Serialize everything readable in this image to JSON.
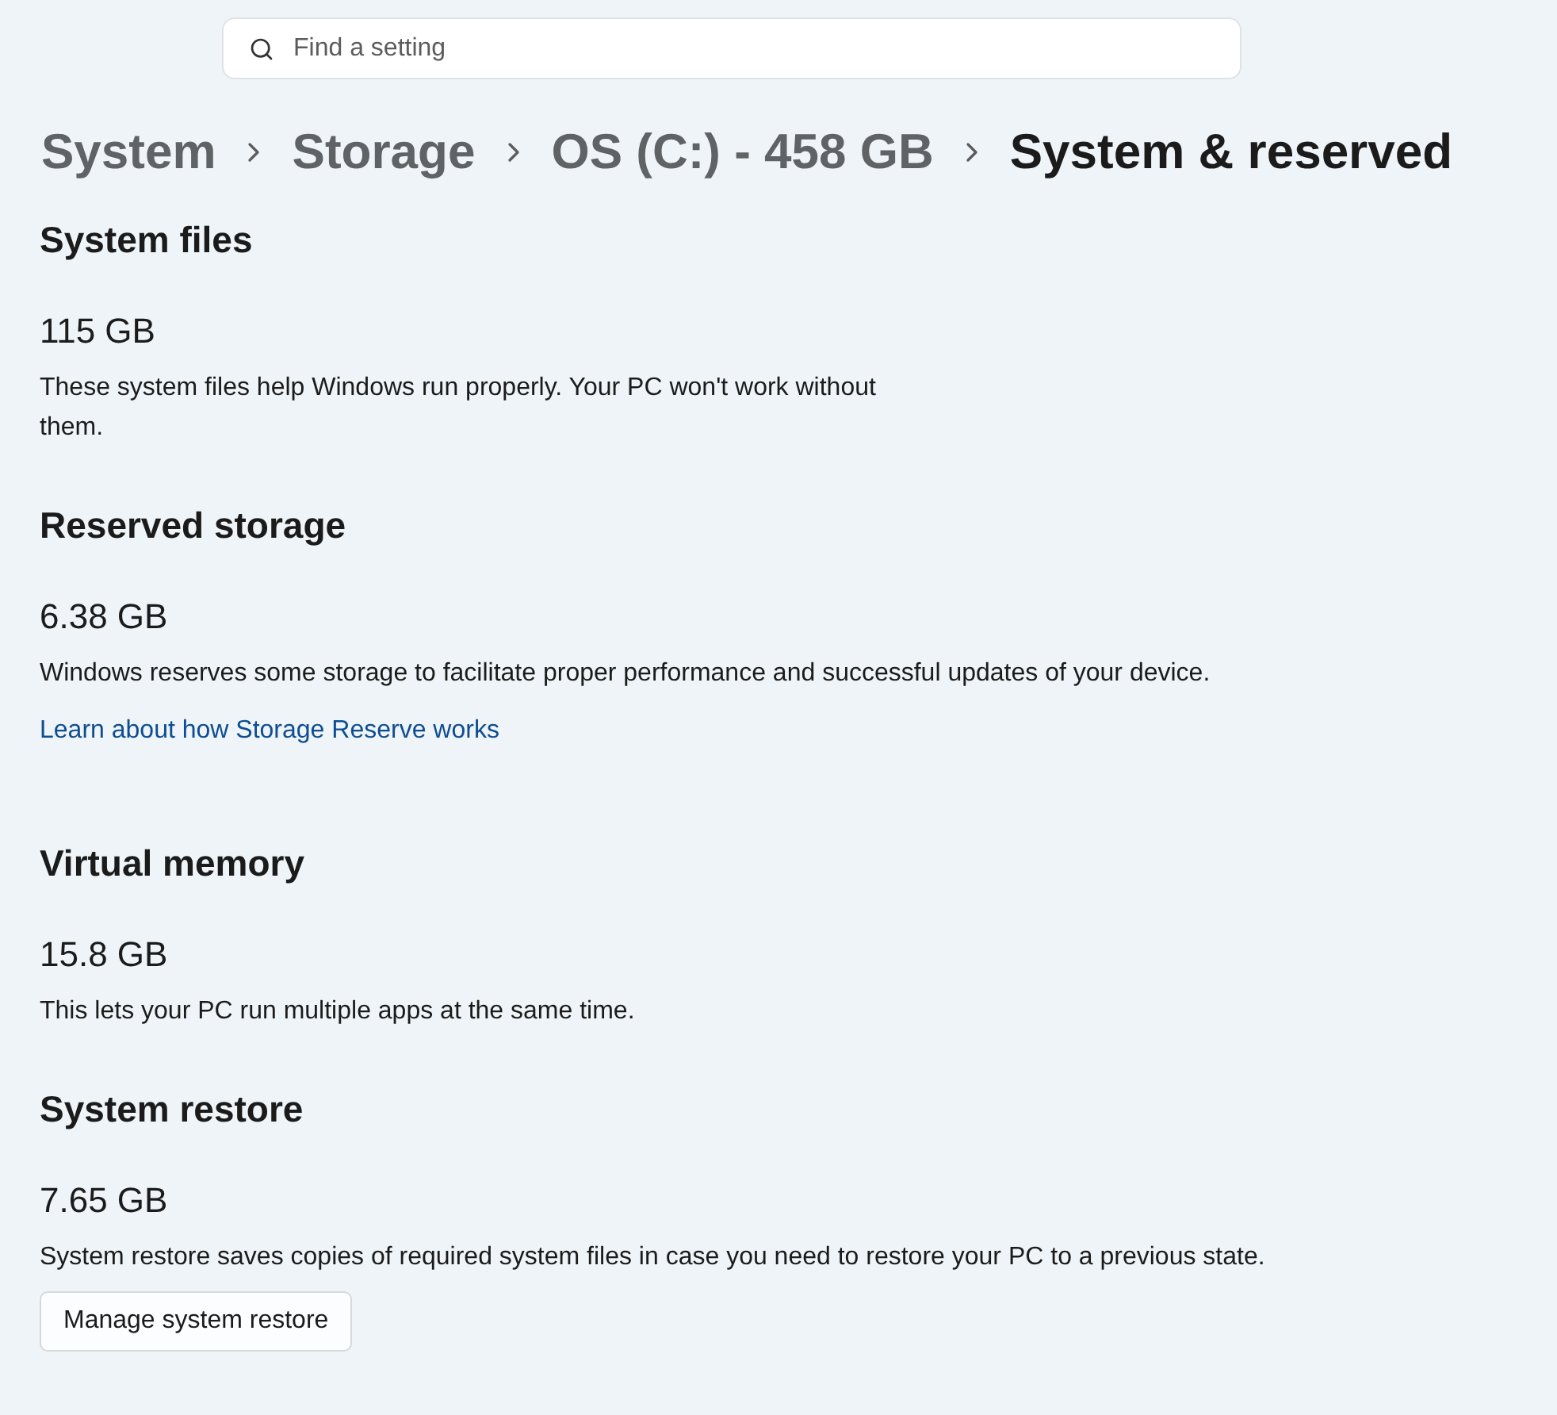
{
  "search": {
    "placeholder": "Find a setting"
  },
  "breadcrumb": [
    {
      "label": "System",
      "current": false
    },
    {
      "label": "Storage",
      "current": false
    },
    {
      "label": "OS (C:) - 458 GB",
      "current": false
    },
    {
      "label": "System & reserved",
      "current": true
    }
  ],
  "sections": [
    {
      "title": "System files",
      "size": "115 GB",
      "description": "These system files help Windows run properly. Your PC won't work without them."
    },
    {
      "title": "Reserved storage",
      "size": "6.38 GB",
      "description": "Windows reserves some storage to facilitate proper performance and successful updates of your device.",
      "link": "Learn about how Storage Reserve works"
    },
    {
      "title": "Virtual memory",
      "size": "15.8 GB",
      "description": "This lets your PC run multiple apps at the same time."
    },
    {
      "title": "System restore",
      "size": "7.65 GB",
      "description": "System restore saves copies of required system files in case you need to restore your PC to a previous state.",
      "button": "Manage system restore"
    }
  ]
}
